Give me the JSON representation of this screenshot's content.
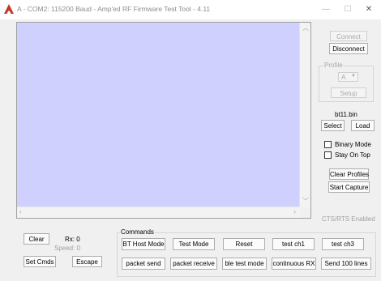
{
  "window": {
    "title": "A - COM2: 115200 Baud - Amp'ed RF Firmware Test Tool - 4.11",
    "minimize": "—",
    "maximize": "☐",
    "close": "✕"
  },
  "right_panel": {
    "connect_label": "Connect",
    "disconnect_label": "Disconnect",
    "profile_group": "Profile",
    "profile_value": "A",
    "setup_label": "Setup",
    "file_name": "bt11.bin",
    "select_label": "Select",
    "load_label": "Load",
    "binary_mode_label": "Binary Mode",
    "stay_on_top_label": "Stay On Top",
    "clear_profiles_label": "Clear Profiles",
    "start_capture_label": "Start Capture",
    "cts_rts_label": "CTS/RTS Enabled"
  },
  "bottom_left": {
    "clear_label": "Clear",
    "rx_label": "Rx: 0",
    "speed_label": "Speed: 0",
    "set_cmds_label": "Set Cmds",
    "escape_label": "Escape"
  },
  "commands": {
    "group_label": "Commands",
    "row1": [
      "BT Host Mode",
      "Test Mode",
      "Reset",
      "test ch1",
      "test ch3"
    ],
    "row2": [
      "packet send",
      "packet receive",
      "ble test mode",
      "continuous RX",
      "Send 100 lines"
    ]
  },
  "icons": {
    "app_icon": "app-logo-icon",
    "scroll_up": "scroll-up-arrow-icon",
    "scroll_down": "scroll-down-arrow-icon",
    "scroll_left": "scroll-left-arrow-icon",
    "scroll_right": "scroll-right-arrow-icon",
    "dropdown": "chevron-down-icon"
  },
  "colors": {
    "output_background": "#d0d0ff",
    "app_icon": "#c0392b"
  }
}
